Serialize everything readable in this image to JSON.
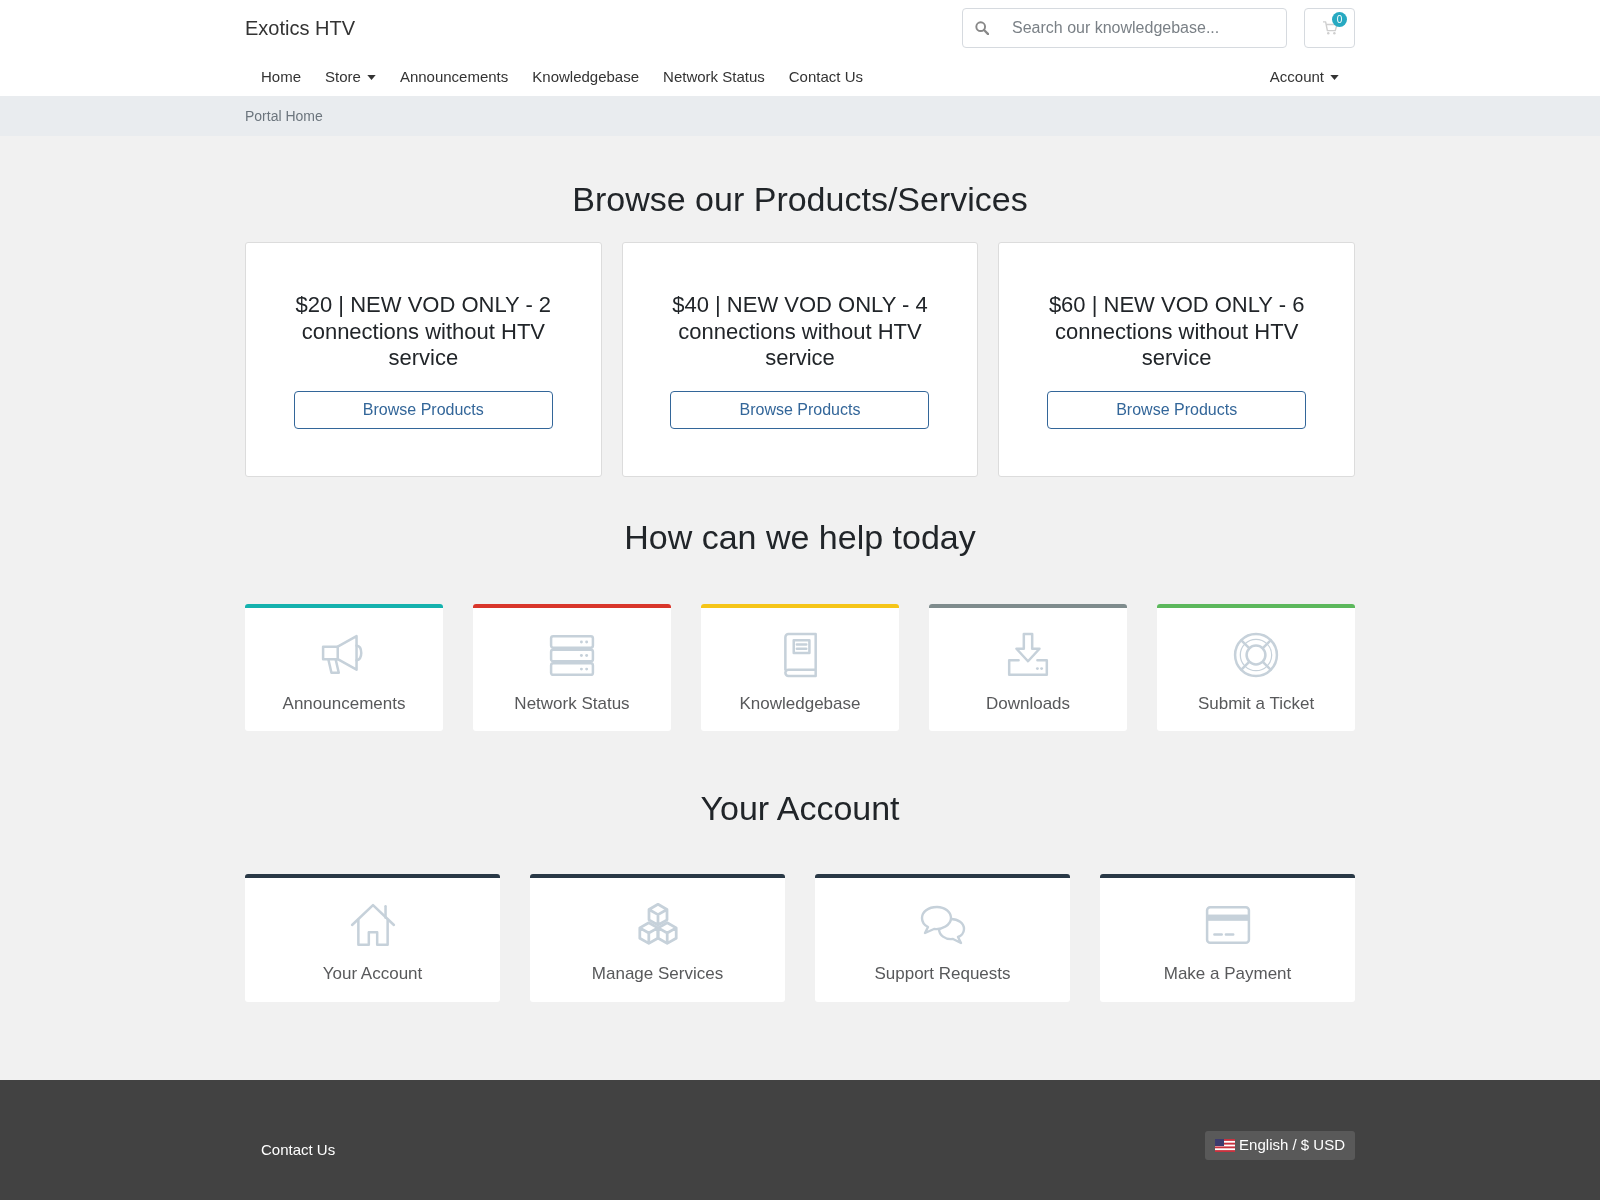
{
  "header": {
    "brand": "Exotics HTV",
    "search": {
      "placeholder": "Search our knowledgebase..."
    },
    "cart": {
      "count": "0"
    }
  },
  "nav": {
    "items": [
      {
        "label": "Home",
        "dropdown": false
      },
      {
        "label": "Store",
        "dropdown": true
      },
      {
        "label": "Announcements",
        "dropdown": false
      },
      {
        "label": "Knowledgebase",
        "dropdown": false
      },
      {
        "label": "Network Status",
        "dropdown": false
      },
      {
        "label": "Contact Us",
        "dropdown": false
      }
    ],
    "account": {
      "label": "Account",
      "dropdown": true
    }
  },
  "breadcrumb": [
    "Portal Home"
  ],
  "products": {
    "heading": "Browse our Products/Services",
    "cards": [
      {
        "title": "$20 | NEW VOD ONLY - 2 connections without HTV service",
        "button": "Browse Products"
      },
      {
        "title": "$40 | NEW VOD ONLY - 4 connections without HTV service",
        "button": "Browse Products"
      },
      {
        "title": "$60 | NEW VOD ONLY - 6 connections without HTV service",
        "button": "Browse Products"
      }
    ]
  },
  "help": {
    "heading": "How can we help today",
    "tiles": [
      {
        "label": "Announcements",
        "color": "#15b2ae"
      },
      {
        "label": "Network Status",
        "color": "#d9362b"
      },
      {
        "label": "Knowledgebase",
        "color": "#f5c518"
      },
      {
        "label": "Downloads",
        "color": "#7f8c8d"
      },
      {
        "label": "Submit a Ticket",
        "color": "#5cb85c"
      }
    ]
  },
  "account": {
    "heading": "Your Account",
    "tiles": [
      {
        "label": "Your Account"
      },
      {
        "label": "Manage Services"
      },
      {
        "label": "Support Requests"
      },
      {
        "label": "Make a Payment"
      }
    ]
  },
  "footer": {
    "links": [
      "Contact Us"
    ],
    "language": "English / $ USD"
  }
}
